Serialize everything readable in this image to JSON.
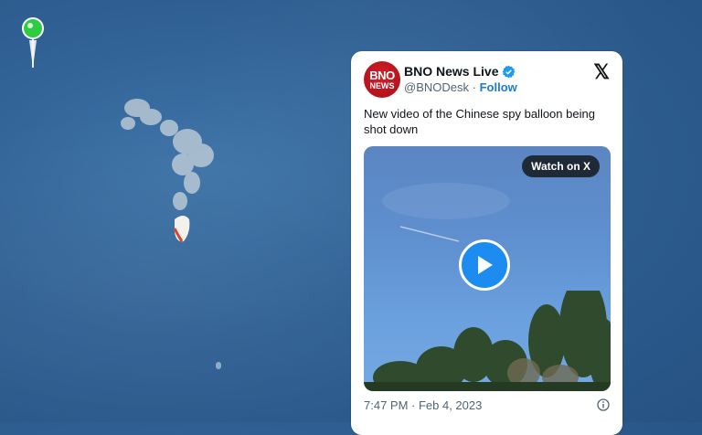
{
  "background": {
    "description_colors": {
      "sky": "#2f5f93"
    }
  },
  "tweet": {
    "account_name": "BNO News Live",
    "handle": "@BNODesk",
    "separator": "·",
    "follow_label": "Follow",
    "avatar_text_top": "BNO",
    "avatar_text_bottom": "NEWS",
    "platform_logo": "𝕏",
    "text": "New video of the Chinese spy balloon being shot down",
    "media": {
      "watch_label": "Watch on X",
      "play_icon": "play-icon"
    },
    "timestamp": "7:47 PM · Feb 4, 2023",
    "colors": {
      "accent": "#1d7bd8",
      "avatar": "#c4161f",
      "play": "#1d8cf0"
    }
  }
}
